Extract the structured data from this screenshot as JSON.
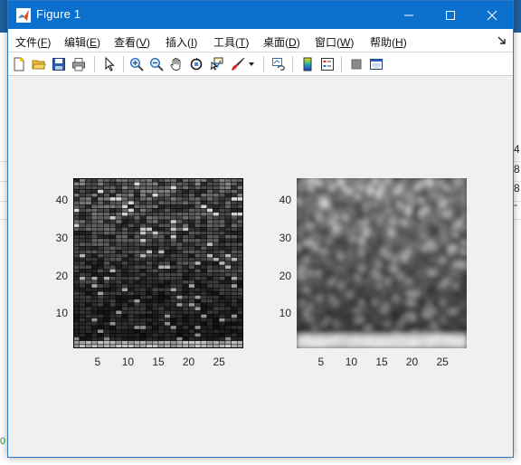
{
  "window": {
    "title": "Figure 1"
  },
  "menu": [
    {
      "label": "文件",
      "key": "F"
    },
    {
      "label": "编辑",
      "key": "E"
    },
    {
      "label": "查看",
      "key": "V"
    },
    {
      "label": "插入",
      "key": "I"
    },
    {
      "label": "工具",
      "key": "T"
    },
    {
      "label": "桌面",
      "key": "D"
    },
    {
      "label": "窗口",
      "key": "W"
    },
    {
      "label": "帮助",
      "key": "H"
    }
  ],
  "toolbar_icons": [
    "new-figure-icon",
    "open-file-icon",
    "save-icon",
    "print-icon",
    "edit-plot-arrow-icon",
    "zoom-in-icon",
    "zoom-out-icon",
    "pan-hand-icon",
    "rotate-3d-icon",
    "data-cursor-icon",
    "brush-icon",
    "brush-dropdown-icon",
    "link-plot-icon",
    "insert-colorbar-icon",
    "insert-legend-icon",
    "hide-plot-tools-icon",
    "show-plot-tools-icon"
  ],
  "background_numbers": [
    "4",
    "8",
    "8",
    "-"
  ],
  "background_text": "0",
  "colors": {
    "titlebar": "#0b6fcd",
    "figure_bg": "#f0f0f0"
  },
  "chart_data": [
    {
      "type": "heatmap",
      "style": "pcolor-grid",
      "colormap": "gray",
      "xticks": [
        5,
        10,
        15,
        20,
        25
      ],
      "yticks": [
        10,
        20,
        30,
        40
      ],
      "xlim": [
        1,
        29
      ],
      "ylim": [
        1,
        46
      ],
      "grid_cells": {
        "cols": 28,
        "rows": 45
      },
      "edge_color": "#000000",
      "xtick_labels": [
        "5",
        "10",
        "15",
        "20",
        "25"
      ],
      "ytick_labels": [
        "10",
        "20",
        "30",
        "40"
      ]
    },
    {
      "type": "heatmap",
      "style": "interpolated-shading",
      "colormap": "gray",
      "xticks": [
        5,
        10,
        15,
        20,
        25
      ],
      "yticks": [
        10,
        20,
        30,
        40
      ],
      "xlim": [
        1,
        29
      ],
      "ylim": [
        1,
        46
      ],
      "xtick_labels": [
        "5",
        "10",
        "15",
        "20",
        "25"
      ],
      "ytick_labels": [
        "10",
        "20",
        "30",
        "40"
      ]
    }
  ]
}
